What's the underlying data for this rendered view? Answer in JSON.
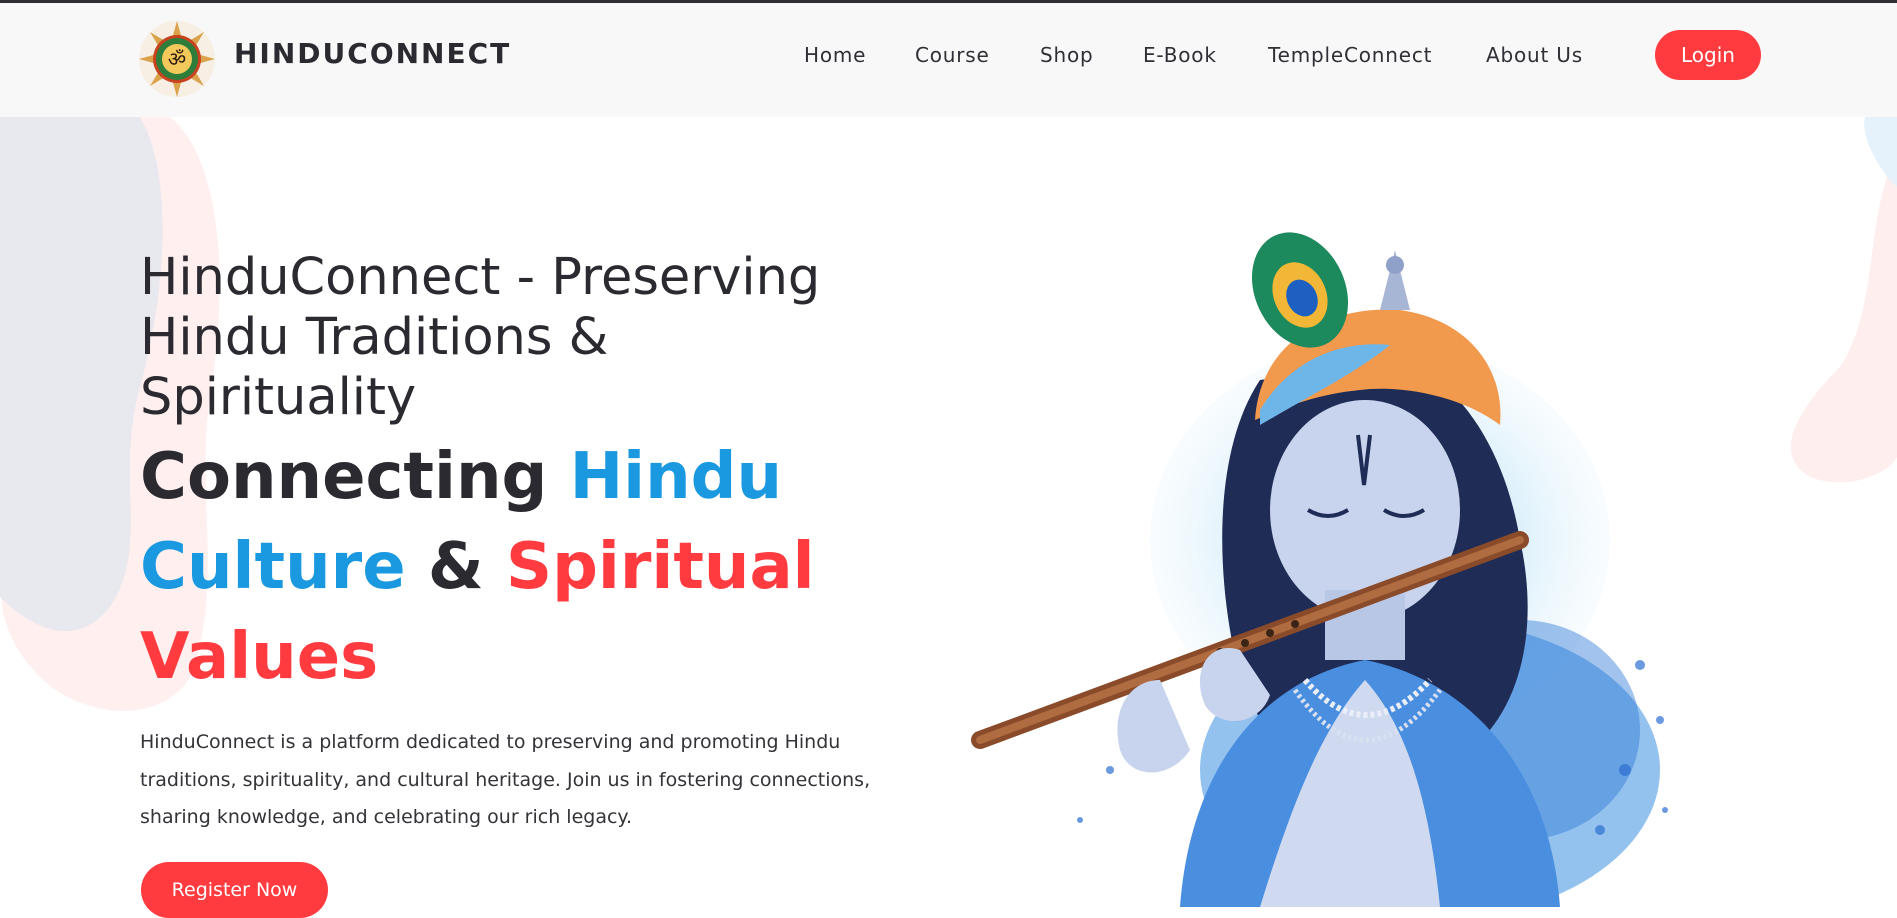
{
  "brand": {
    "name": "HINDUCONNECT",
    "logo_icon": "om-mandala-icon",
    "colors": {
      "accent_red": "#ff3b3f",
      "accent_blue": "#1a99e0",
      "text_dark": "#2a2a30"
    }
  },
  "nav": {
    "items": [
      {
        "label": "Home"
      },
      {
        "label": "Course"
      },
      {
        "label": "Shop"
      },
      {
        "label": "E-Book"
      },
      {
        "label": "TempleConnect"
      },
      {
        "label": "About Us"
      }
    ],
    "login_label": "Login"
  },
  "hero": {
    "title": "HinduConnect - Preserving Hindu Traditions & Spirituality",
    "tagline": {
      "part1": "Connecting ",
      "part2": "Hindu Culture",
      "part3": " & ",
      "part4": "Spiritual Values"
    },
    "description": "HinduConnect is a platform dedicated to preserving and promoting Hindu traditions, spirituality, and cultural heritage. Join us in fostering connections, sharing knowledge, and celebrating our rich legacy.",
    "register_label": "Register Now",
    "image_icon": "krishna-flute-illustration-icon"
  }
}
